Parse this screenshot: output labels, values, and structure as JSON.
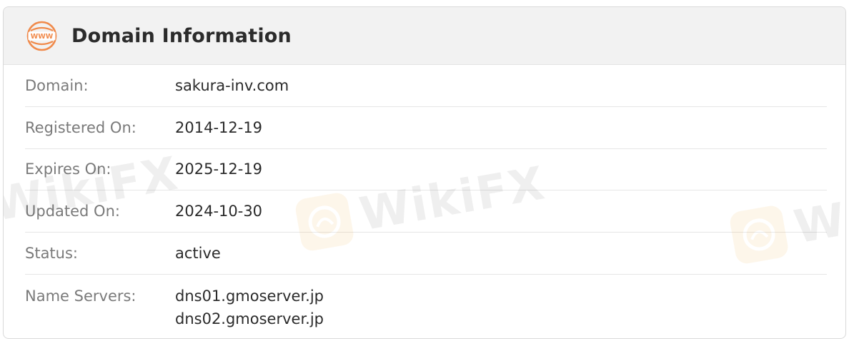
{
  "header": {
    "title": "Domain Information",
    "icon": "www-globe-icon",
    "icon_color": "#f08a4b"
  },
  "rows": [
    {
      "label": "Domain:",
      "value": "sakura-inv.com"
    },
    {
      "label": "Registered On:",
      "value": "2014-12-19"
    },
    {
      "label": "Expires On:",
      "value": "2025-12-19"
    },
    {
      "label": "Updated On:",
      "value": "2024-10-30"
    },
    {
      "label": "Status:",
      "value": "active"
    }
  ],
  "name_servers": {
    "label": "Name Servers:",
    "values": [
      "dns01.gmoserver.jp",
      "dns02.gmoserver.jp"
    ]
  },
  "watermark": {
    "text": "WikiFX",
    "color": "#f2a024"
  }
}
